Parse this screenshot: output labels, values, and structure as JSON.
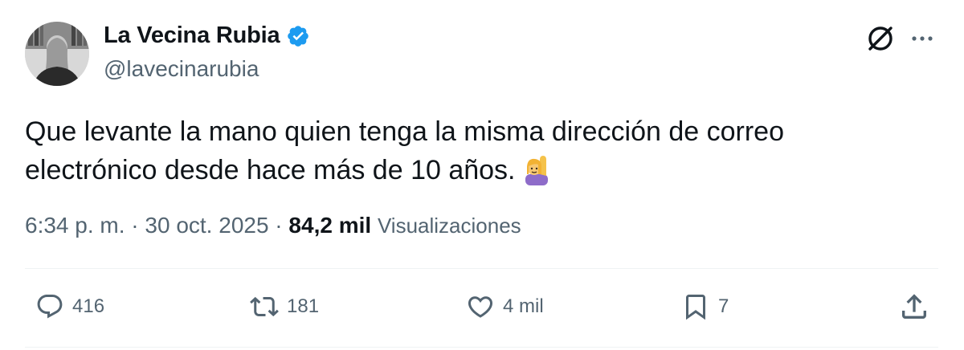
{
  "author": {
    "display_name": "La Vecina Rubia",
    "handle": "@lavecinarubia",
    "verified": true,
    "verified_color": "#1d9bf0"
  },
  "tweet": {
    "text_line1": "Que levante la mano quien tenga la misma dirección de correo",
    "text_line2": "electrónico desde hace más de 10 años.",
    "emoji": "person-raising-hand-emoji"
  },
  "meta": {
    "time": "6:34 p. m.",
    "sep1": " · ",
    "date": "30 oct. 2025",
    "sep2": " · ",
    "views_count": "84,2 mil",
    "views_label": "Visualizaciones"
  },
  "actions": {
    "replies": "416",
    "reposts": "181",
    "likes": "4 mil",
    "bookmarks": "7"
  },
  "icons": {
    "top_right": [
      "grok-icon",
      "more-icon"
    ],
    "actions": [
      "reply-icon",
      "repost-icon",
      "like-icon",
      "bookmark-icon",
      "share-icon"
    ]
  },
  "colors": {
    "text_primary": "#0f1419",
    "text_secondary": "#536471",
    "divider": "#eff3f4"
  }
}
